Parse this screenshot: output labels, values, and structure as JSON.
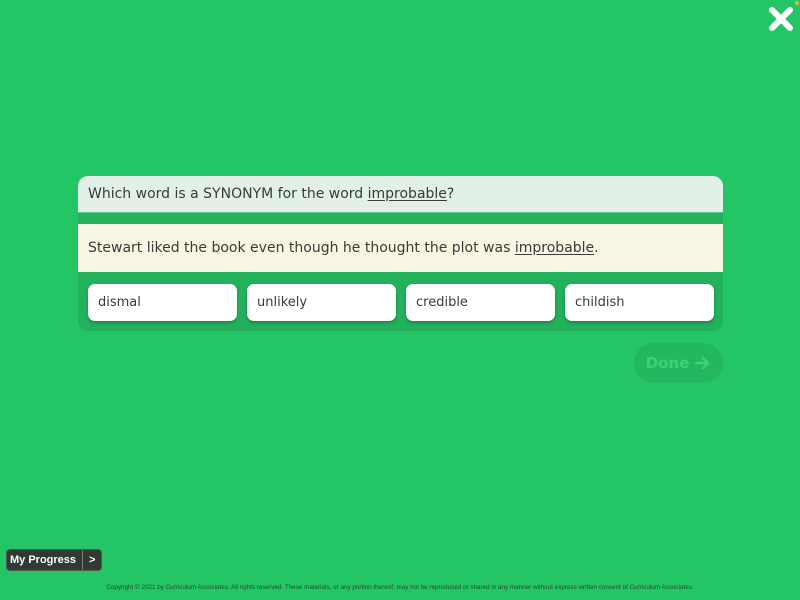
{
  "colors": {
    "background": "#24c565",
    "card_frame": "#23b15c",
    "prompt_bg": "#e2f0e7",
    "passage_bg": "#f8f6e2",
    "choice_bg": "#ffffff",
    "text": "#3a3a3a"
  },
  "close": {
    "icon": "close-icon"
  },
  "question": {
    "prompt_before": "Which word is a SYNONYM for the word ",
    "prompt_target": "improbable",
    "prompt_after": "?",
    "passage_before": "Stewart liked the book even though he thought the plot was ",
    "passage_target": "improbable",
    "passage_after": "."
  },
  "choices": [
    {
      "label": "dismal"
    },
    {
      "label": "unlikely"
    },
    {
      "label": "credible"
    },
    {
      "label": "childish"
    }
  ],
  "done": {
    "label": "Done",
    "icon": "arrow-right-icon",
    "enabled": false
  },
  "progress": {
    "label": "My Progress",
    "arrow": ">"
  },
  "footer": {
    "copyright": "Copyright © 2021 by Curriculum Associates. All rights reserved. These materials, or any portion thereof, may not be reproduced or shared in any manner without express written consent of Curriculum Associates."
  }
}
